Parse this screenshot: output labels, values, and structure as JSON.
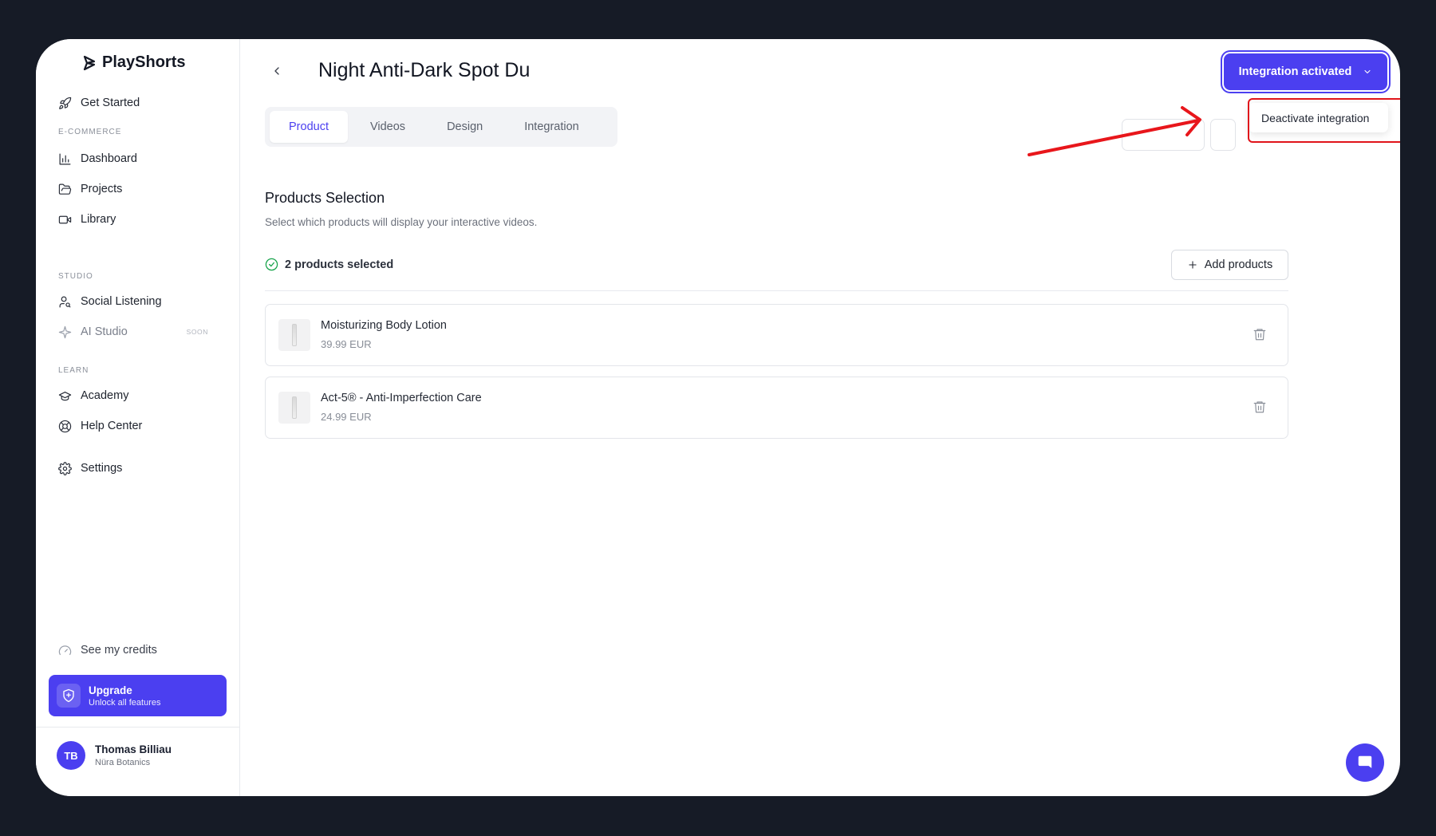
{
  "app": {
    "name": "PlayShorts"
  },
  "sidebar": {
    "get_started": "Get Started",
    "sections": {
      "ecommerce": "E-COMMERCE",
      "studio": "STUDIO",
      "learn": "LEARN"
    },
    "items": {
      "dashboard": "Dashboard",
      "projects": "Projects",
      "library": "Library",
      "social_listening": "Social Listening",
      "ai_studio": "AI Studio",
      "ai_studio_badge": "SOON",
      "academy": "Academy",
      "help_center": "Help Center",
      "settings": "Settings"
    },
    "credits": "See my credits",
    "upgrade": {
      "title": "Upgrade",
      "subtitle": "Unlock all features"
    },
    "user": {
      "initials": "TB",
      "name": "Thomas Billiau",
      "org": "Nüra Botanics"
    }
  },
  "header": {
    "title": "Night Anti-Dark Spot Du",
    "integration_button": "Integration activated",
    "dropdown_item": "Deactivate integration"
  },
  "tabs": [
    "Product",
    "Videos",
    "Design",
    "Integration"
  ],
  "active_tab": "Product",
  "products_section": {
    "title": "Products Selection",
    "description": "Select which products will display your interactive videos.",
    "selected_count": "2 products selected",
    "add_button": "Add products"
  },
  "products": [
    {
      "name": "Moisturizing Body Lotion",
      "price": "39.99 EUR"
    },
    {
      "name": "Act-5® - Anti-Imperfection Care",
      "price": "24.99 EUR"
    }
  ],
  "colors": {
    "accent": "#4b3ff0",
    "annotation": "#e0141a",
    "success": "#16a34a"
  }
}
